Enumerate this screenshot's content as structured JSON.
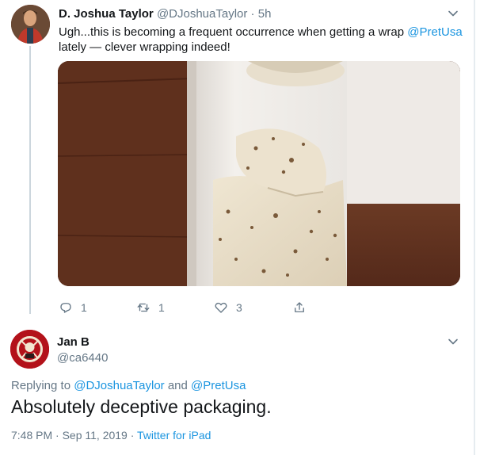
{
  "tweet": {
    "author_name": "D. Joshua Taylor",
    "author_handle": "@DJoshuaTaylor",
    "separator": " · ",
    "time": "5h",
    "text_before": "Ugh...this is becoming a frequent occurrence when getting a wrap ",
    "text_mention": "@PretUsa",
    "text_after": " lately — clever wrapping indeed!",
    "stats": {
      "replies": "1",
      "retweets": "1",
      "likes": "3"
    }
  },
  "reply": {
    "author_name": "Jan B",
    "author_handle": "@ca6440",
    "replying_prefix": "Replying to ",
    "replying_to_1": "@DJoshuaTaylor",
    "replying_and": " and ",
    "replying_to_2": "@PretUsa",
    "text": "Absolutely deceptive packaging.",
    "timestamp": "7:48 PM · Sep 11, 2019 · ",
    "source": "Twitter for iPad"
  },
  "colors": {
    "link": "#1b95e0",
    "secondary_text": "#657786",
    "thread_line": "#ccd6dd"
  },
  "icons": {
    "reply": "reply-icon",
    "retweet": "retweet-icon",
    "like": "heart-icon",
    "share": "share-icon",
    "menu": "chevron-down-icon"
  }
}
